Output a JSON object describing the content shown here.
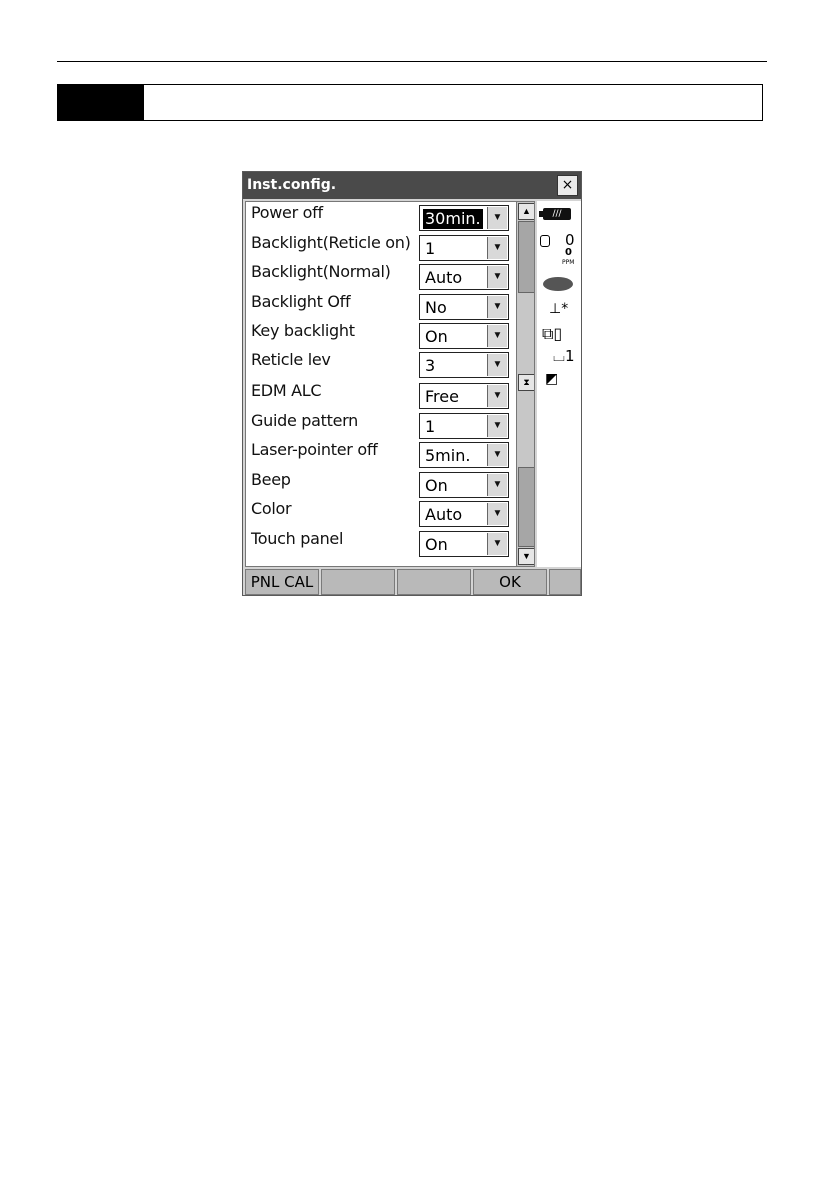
{
  "window": {
    "title": "Inst.config.",
    "close_label": "×"
  },
  "settings": [
    {
      "label": "Power off",
      "value": "30min.",
      "highlighted": true
    },
    {
      "label": "Backlight(Reticle on)",
      "value": "1"
    },
    {
      "label": "Backlight(Normal)",
      "value": "Auto"
    },
    {
      "label": "Backlight Off",
      "value": "No"
    },
    {
      "label": "Key backlight",
      "value": "On"
    },
    {
      "label": "Reticle lev",
      "value": "3"
    },
    {
      "label": "EDM ALC",
      "value": "Free"
    },
    {
      "label": "Guide pattern",
      "value": "1"
    },
    {
      "label": "Laser-pointer off",
      "value": "5min."
    },
    {
      "label": "Beep",
      "value": "On"
    },
    {
      "label": "Color",
      "value": "Auto"
    },
    {
      "label": "Touch panel",
      "value": "On"
    }
  ],
  "scrollbar": {
    "up": "▲",
    "down": "▼",
    "mid": "⧗"
  },
  "status": {
    "battery": "///",
    "ppm_value": "0",
    "ppm_sub": "0",
    "ppm_unit": "PPM",
    "tilt": "⊥*",
    "rec": "⧉▯",
    "face": "⌴1",
    "draw": "◩"
  },
  "softkeys": [
    "PNL CAL",
    "",
    "",
    "OK",
    ""
  ],
  "icons": {
    "dropdown": "chevron-down-icon",
    "battery": "battery-icon",
    "target": "prism-target-icon"
  }
}
